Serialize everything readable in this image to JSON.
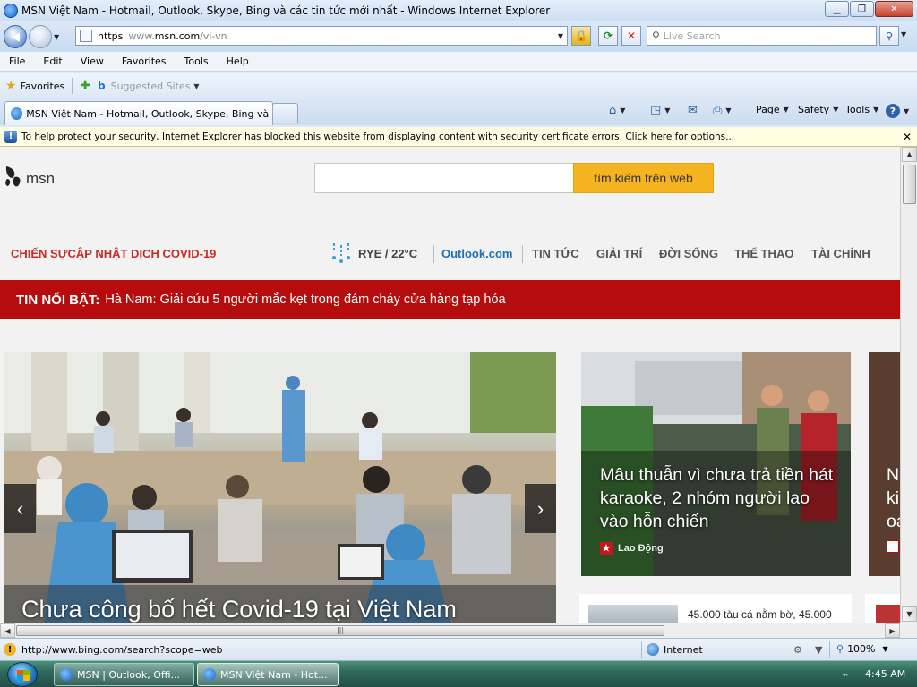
{
  "window": {
    "title": "MSN Việt Nam - Hotmail, Outlook, Skype, Bing và các tin tức mới nhất - Windows Internet Explorer",
    "minimize": "▁",
    "maximize": "❐",
    "close": "✕"
  },
  "address_bar": {
    "scheme": "https",
    "host_prefix": "www.",
    "host": "msn.com",
    "path": "/vi-vn"
  },
  "search_bar": {
    "placeholder": "Live Search"
  },
  "menu": [
    "File",
    "Edit",
    "View",
    "Favorites",
    "Tools",
    "Help"
  ],
  "favorites_bar": {
    "favorites_label": "Favorites",
    "suggested_label": "Suggested Sites"
  },
  "tab": {
    "label": "MSN Việt Nam - Hotmail, Outlook, Skype, Bing và c..."
  },
  "command_bar": {
    "page": "Page",
    "safety": "Safety",
    "tools": "Tools"
  },
  "info_bar": {
    "text": "To help protect your security, Internet Explorer has blocked this website from displaying content with security certificate errors. Click here for options..."
  },
  "msn": {
    "logo_text": "msn",
    "search_button": "tìm kiếm trên web",
    "covid_link": "CHIẾN SỰCẬP NHẬT DỊCH COVID-19",
    "weather": "RYE / 22°C",
    "outlook": "Outlook.com",
    "nav": [
      "TIN TỨC",
      "GIẢI TRÍ",
      "ĐỜI SỐNG",
      "THỂ THAO",
      "TÀI CHÍNH"
    ],
    "breaking_label": "TIN NỔI BẬT:",
    "breaking_text": "Hà Nam: Giải cứu 5 người mắc kẹt trong đám cháy cửa hàng tạp hóa",
    "hero_caption": "Chưa công bố hết Covid-19 tại Việt Nam",
    "card_title": "Mâu thuẫn vì chưa trả tiền hát karaoke, 2 nhóm người lao vào hỗn chiến",
    "card_source": "Lao Động",
    "card2_text": "N ki oa",
    "small_card_text": "45.000 tàu cá nằm bờ, 45.000"
  },
  "status_bar": {
    "url": "http://www.bing.com/search?scope=web",
    "zone": "Internet",
    "zoom": "100%"
  },
  "taskbar": {
    "tasks": [
      "MSN | Outlook, Offi...",
      "MSN Việt Nam - Hot..."
    ],
    "clock": "4:45 AM"
  }
}
